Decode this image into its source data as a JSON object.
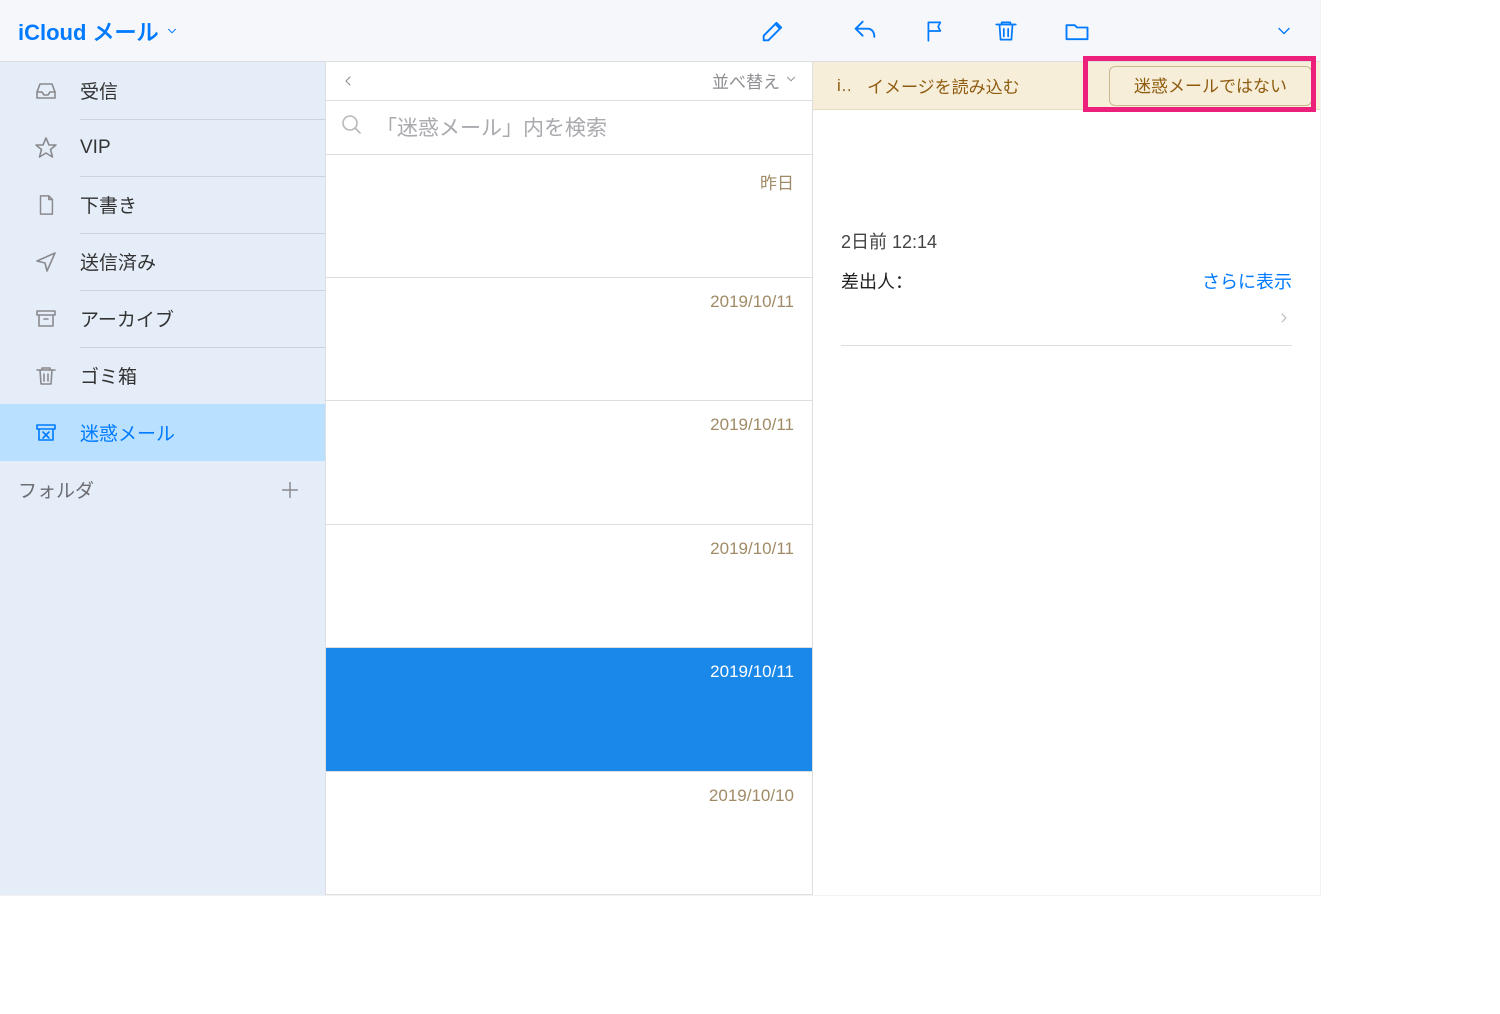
{
  "app": {
    "title": "iCloud メール"
  },
  "sidebar": {
    "items": [
      {
        "label": "受信",
        "icon": "inbox"
      },
      {
        "label": "VIP",
        "icon": "star"
      },
      {
        "label": "下書き",
        "icon": "draft"
      },
      {
        "label": "送信済み",
        "icon": "sent"
      },
      {
        "label": "アーカイブ",
        "icon": "archive"
      },
      {
        "label": "ゴミ箱",
        "icon": "trash"
      },
      {
        "label": "迷惑メール",
        "icon": "junk",
        "selected": true
      }
    ],
    "folders_label": "フォルダ"
  },
  "list": {
    "sort_label": "並べ替え",
    "search_placeholder": "「迷惑メール」内を検索",
    "messages": [
      {
        "date": "昨日"
      },
      {
        "date": "2019/10/11"
      },
      {
        "date": "2019/10/11"
      },
      {
        "date": "2019/10/11"
      },
      {
        "date": "2019/10/11",
        "selected": true
      },
      {
        "date": "2019/10/10"
      }
    ]
  },
  "reader": {
    "banner": {
      "truncated_prefix": "i…",
      "load_images": "イメージを読み込む",
      "not_junk": "迷惑メールではない"
    },
    "timestamp": "2日前 12:14",
    "from_label": "差出人：",
    "more_label": "さらに表示"
  },
  "annotation": {
    "highlight_target": "not-junk-button"
  }
}
